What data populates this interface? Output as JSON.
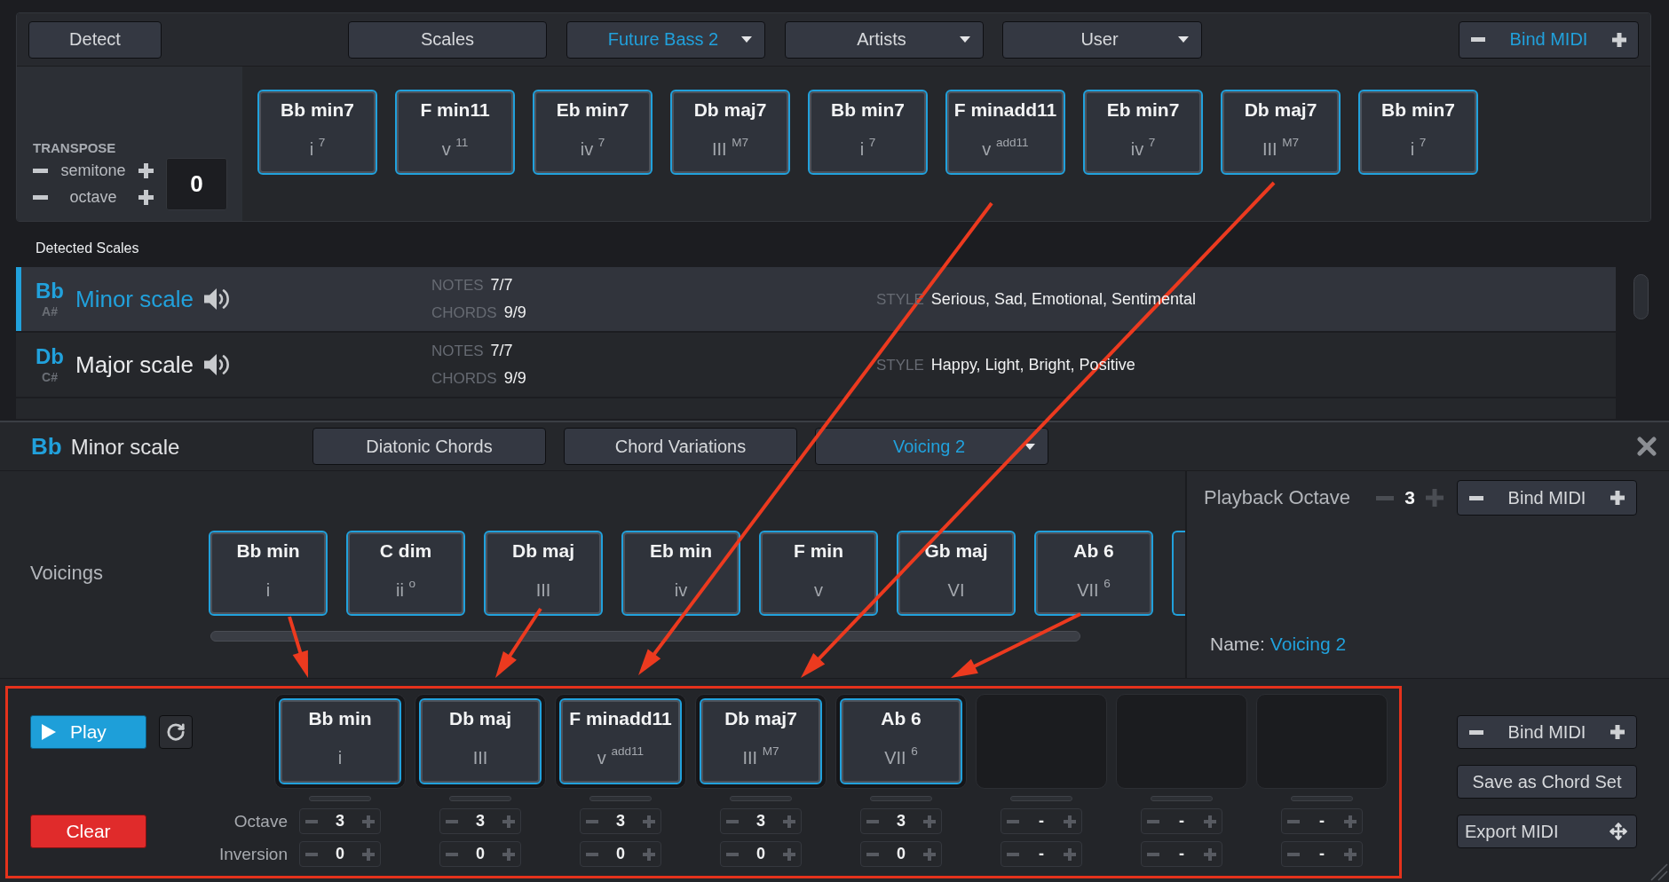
{
  "toolbar": {
    "items": [
      {
        "label": "Detect",
        "kind": "button",
        "selected": false
      },
      {
        "label": "Scales",
        "kind": "button",
        "selected": false
      },
      {
        "label": "Future Bass 2",
        "kind": "dropdown",
        "selected": true
      },
      {
        "label": "Artists",
        "kind": "dropdown",
        "selected": false
      },
      {
        "label": "User",
        "kind": "dropdown",
        "selected": false
      }
    ],
    "bind_midi": {
      "label": "Bind MIDI",
      "active": true
    }
  },
  "transpose": {
    "title": "TRANSPOSE",
    "steps": [
      {
        "label": "semitone"
      },
      {
        "label": "octave"
      }
    ],
    "value": "0"
  },
  "chord_strip": [
    {
      "name": "Bb min7",
      "numeral": "i $^{7}$"
    },
    {
      "name": "F min11",
      "numeral": "v $^{11}$"
    },
    {
      "name": "Eb min7",
      "numeral": "iv $^{7}$"
    },
    {
      "name": "Db maj7",
      "numeral": "III $^{M7}$"
    },
    {
      "name": "Bb min7",
      "numeral": "i $^{7}$"
    },
    {
      "name": "F minadd11",
      "numeral": "v $^{add11}$"
    },
    {
      "name": "Eb min7",
      "numeral": "iv $^{7}$"
    },
    {
      "name": "Db maj7",
      "numeral": "III $^{M7}$"
    },
    {
      "name": "Bb min7",
      "numeral": "i $^{7}$"
    }
  ],
  "detected_scales": {
    "title": "Detected Scales",
    "rows": [
      {
        "root": "Bb",
        "alt_root": "A#",
        "name": "Minor scale",
        "notes_label": "NOTES",
        "notes": "7/7",
        "chords_label": "CHORDS",
        "chords": "9/9",
        "style_label": "STYLE",
        "style": "Serious, Sad, Emotional, Sentimental",
        "selected": true
      },
      {
        "root": "Db",
        "alt_root": "C#",
        "name": "Major scale",
        "notes_label": "NOTES",
        "notes": "7/7",
        "chords_label": "CHORDS",
        "chords": "9/9",
        "style_label": "STYLE",
        "style": "Happy, Light, Bright, Positive",
        "selected": false
      }
    ]
  },
  "scale_panel": {
    "root": "Bb",
    "name": "Minor scale",
    "tabs": [
      {
        "label": "Diatonic Chords",
        "kind": "button",
        "selected": false
      },
      {
        "label": "Chord Variations",
        "kind": "button",
        "selected": false
      },
      {
        "label": "Voicing 2",
        "kind": "dropdown",
        "selected": true
      }
    ]
  },
  "voicings": {
    "label": "Voicings",
    "chords": [
      {
        "name": "Bb min",
        "numeral": "i"
      },
      {
        "name": "C dim",
        "numeral": "ii $^{o}$"
      },
      {
        "name": "Db maj",
        "numeral": "III"
      },
      {
        "name": "Eb min",
        "numeral": "iv"
      },
      {
        "name": "F min",
        "numeral": "v"
      },
      {
        "name": "Gb maj",
        "numeral": "VI"
      },
      {
        "name": "Ab 6",
        "numeral": "VII $^{6}$"
      }
    ]
  },
  "playback": {
    "label": "Playback Octave",
    "value": "3",
    "bind_midi": {
      "label": "Bind MIDI",
      "active": false
    },
    "name_label": "Name:",
    "name_value": "Voicing 2"
  },
  "progression": {
    "play": "Play",
    "clear": "Clear",
    "octave_label": "Octave",
    "inversion_label": "Inversion",
    "slots": [
      {
        "kind": "chord",
        "name": "Bb min",
        "numeral": "i",
        "octave": "3",
        "inversion": "0"
      },
      {
        "kind": "chord",
        "name": "Db maj",
        "numeral": "III",
        "octave": "3",
        "inversion": "0"
      },
      {
        "kind": "chord",
        "name": "F minadd11",
        "numeral": "v $^{add11}$",
        "octave": "3",
        "inversion": "0"
      },
      {
        "kind": "chord",
        "name": "Db maj7",
        "numeral": "III $^{M7}$",
        "octave": "3",
        "inversion": "0"
      },
      {
        "kind": "chord",
        "name": "Ab 6",
        "numeral": "VII $^{6}$",
        "octave": "3",
        "inversion": "0"
      },
      {
        "kind": "empty",
        "octave": "-",
        "inversion": "-"
      },
      {
        "kind": "empty",
        "octave": "-",
        "inversion": "-"
      },
      {
        "kind": "empty",
        "octave": "-",
        "inversion": "-"
      }
    ]
  },
  "side_buttons": [
    {
      "label": "Bind MIDI",
      "kind": "bind"
    },
    {
      "label": "Save as Chord Set",
      "kind": "plain"
    },
    {
      "label": "Export MIDI",
      "kind": "export"
    }
  ]
}
